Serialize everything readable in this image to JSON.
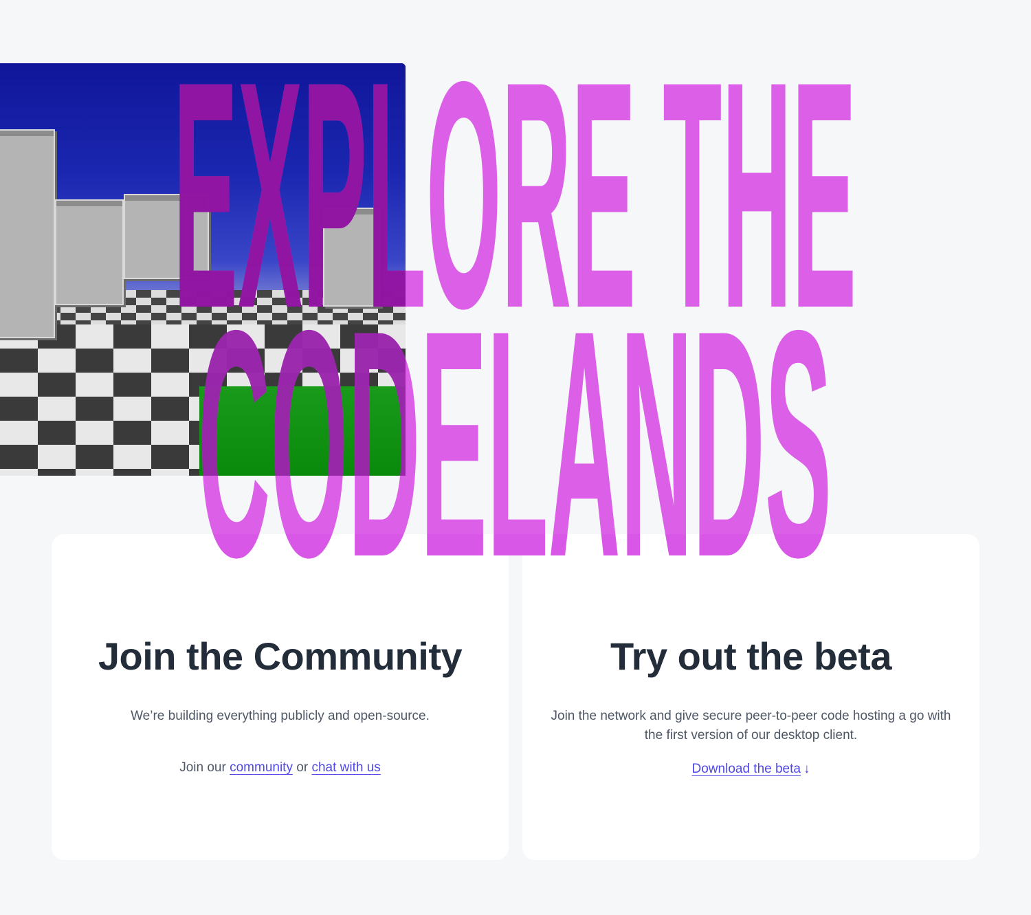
{
  "hero": {
    "line1": "EXPLORE THE",
    "line2": "CODELANDS",
    "accent_color": "#d957e6"
  },
  "community": {
    "title": "Join the Community",
    "description": "We’re building everything publicly and open-source.",
    "join_prefix": "Join our",
    "community_link": "community",
    "or_text": "or",
    "chat_link": "chat with us"
  },
  "beta": {
    "title": "Try out the beta",
    "description": "Join the network and give secure peer-to-peer code hosting a go with the first version of our desktop client.",
    "download_link": "Download the beta",
    "download_arrow": "↓"
  },
  "colors": {
    "background": "#f6f7f9",
    "card": "#ffffff",
    "heading": "#232c39",
    "link": "#5048e5"
  }
}
